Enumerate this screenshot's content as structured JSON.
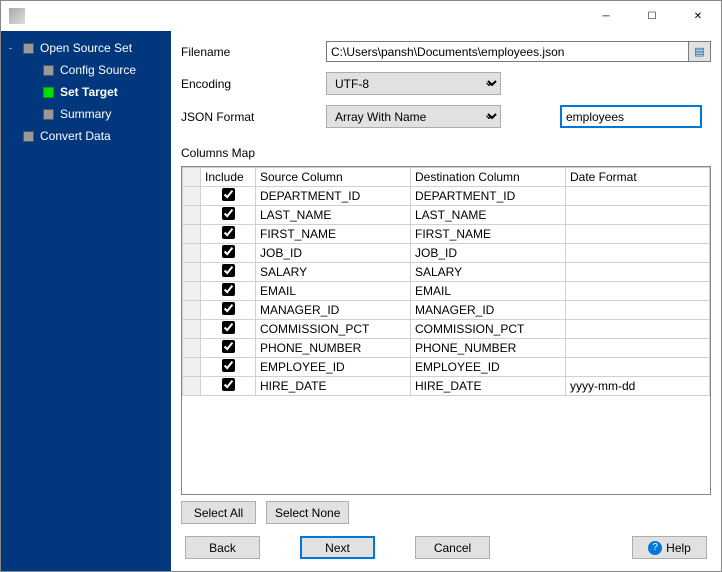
{
  "sidebar": {
    "items": [
      {
        "label": "Open Source Set",
        "active": false,
        "sub": false,
        "expander": "-"
      },
      {
        "label": "Config Source",
        "active": false,
        "sub": true,
        "expander": ""
      },
      {
        "label": "Set Target",
        "active": true,
        "sub": true,
        "expander": ""
      },
      {
        "label": "Summary",
        "active": false,
        "sub": true,
        "expander": ""
      },
      {
        "label": "Convert Data",
        "active": false,
        "sub": false,
        "expander": ""
      }
    ]
  },
  "form": {
    "filename_label": "Filename",
    "filename_value": "C:\\Users\\pansh\\Documents\\employees.json",
    "encoding_label": "Encoding",
    "encoding_value": "UTF-8",
    "jsonformat_label": "JSON Format",
    "jsonformat_value": "Array With Name",
    "name_value": "employees"
  },
  "columns": {
    "section_label": "Columns Map",
    "headers": {
      "include": "Include",
      "source": "Source Column",
      "dest": "Destination Column",
      "datefmt": "Date Format"
    },
    "rows": [
      {
        "inc": true,
        "src": "DEPARTMENT_ID",
        "dst": "DEPARTMENT_ID",
        "fmt": ""
      },
      {
        "inc": true,
        "src": "LAST_NAME",
        "dst": "LAST_NAME",
        "fmt": ""
      },
      {
        "inc": true,
        "src": "FIRST_NAME",
        "dst": "FIRST_NAME",
        "fmt": ""
      },
      {
        "inc": true,
        "src": "JOB_ID",
        "dst": "JOB_ID",
        "fmt": ""
      },
      {
        "inc": true,
        "src": "SALARY",
        "dst": "SALARY",
        "fmt": ""
      },
      {
        "inc": true,
        "src": "EMAIL",
        "dst": "EMAIL",
        "fmt": ""
      },
      {
        "inc": true,
        "src": "MANAGER_ID",
        "dst": "MANAGER_ID",
        "fmt": ""
      },
      {
        "inc": true,
        "src": "COMMISSION_PCT",
        "dst": "COMMISSION_PCT",
        "fmt": ""
      },
      {
        "inc": true,
        "src": "PHONE_NUMBER",
        "dst": "PHONE_NUMBER",
        "fmt": ""
      },
      {
        "inc": true,
        "src": "EMPLOYEE_ID",
        "dst": "EMPLOYEE_ID",
        "fmt": ""
      },
      {
        "inc": true,
        "src": "HIRE_DATE",
        "dst": "HIRE_DATE",
        "fmt": "yyyy-mm-dd"
      }
    ]
  },
  "buttons": {
    "select_all": "Select All",
    "select_none": "Select None",
    "back": "Back",
    "next": "Next",
    "cancel": "Cancel",
    "help": "Help"
  }
}
